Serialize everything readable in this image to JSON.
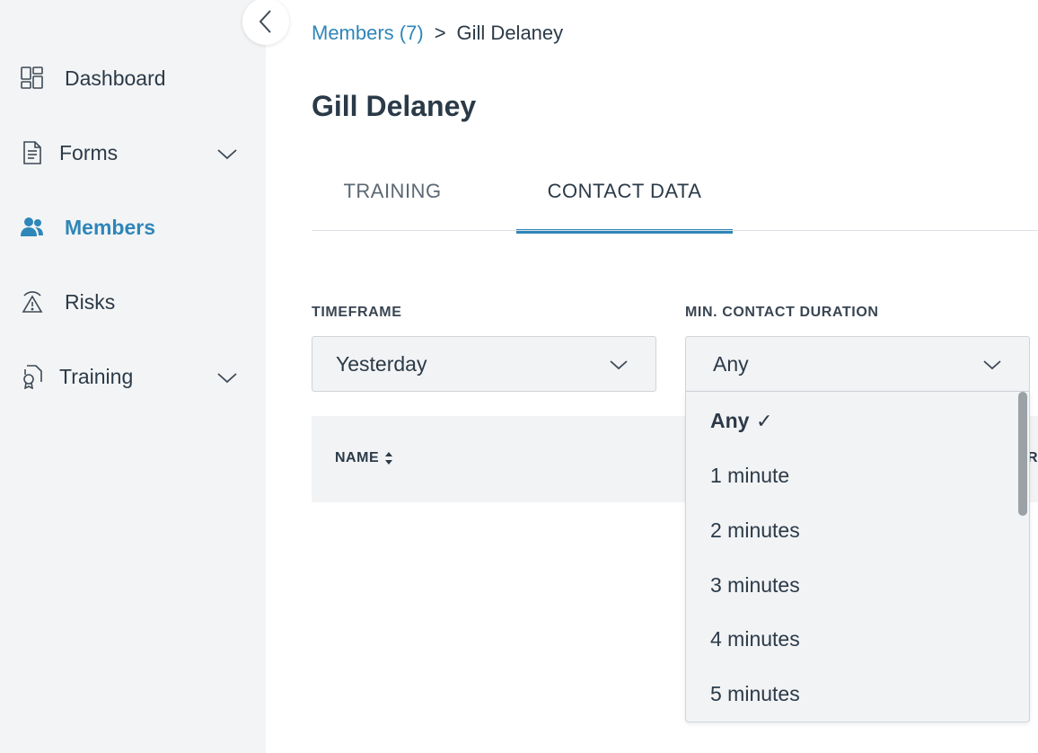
{
  "sidebar": {
    "collapse_icon": "chevron-left-icon",
    "items": [
      {
        "label": "Dashboard",
        "icon": "dashboard-grid-icon",
        "active": false,
        "expandable": false
      },
      {
        "label": "Forms",
        "icon": "form-document-icon",
        "active": false,
        "expandable": true
      },
      {
        "label": "Members",
        "icon": "people-icon",
        "active": true,
        "expandable": false
      },
      {
        "label": "Risks",
        "icon": "warning-triangle-icon",
        "active": false,
        "expandable": false
      },
      {
        "label": "Training",
        "icon": "certificate-icon",
        "active": false,
        "expandable": true
      }
    ]
  },
  "breadcrumb": {
    "parent": "Members (7)",
    "separator": ">",
    "current": "Gill Delaney"
  },
  "page": {
    "title": "Gill Delaney"
  },
  "tabs": [
    {
      "label": "TRAINING",
      "active": false
    },
    {
      "label": "CONTACT DATA",
      "active": true
    }
  ],
  "filters": {
    "timeframe": {
      "label": "TIMEFRAME",
      "value": "Yesterday"
    },
    "duration": {
      "label": "MIN. CONTACT DURATION",
      "value": "Any",
      "options": [
        {
          "label": "Any",
          "selected": true
        },
        {
          "label": "1 minute",
          "selected": false
        },
        {
          "label": "2 minutes",
          "selected": false
        },
        {
          "label": "3 minutes",
          "selected": false
        },
        {
          "label": "4 minutes",
          "selected": false
        },
        {
          "label": "5 minutes",
          "selected": false
        }
      ],
      "check_mark": "✓"
    }
  },
  "table": {
    "columns": [
      {
        "label": "NAME",
        "sortable": true
      },
      {
        "label": "R",
        "sortable": false
      }
    ]
  },
  "colors": {
    "accent": "#2f86b8",
    "text": "#2b3a48",
    "sidebar_bg": "#f3f4f5",
    "field_bg": "#f2f3f5"
  }
}
